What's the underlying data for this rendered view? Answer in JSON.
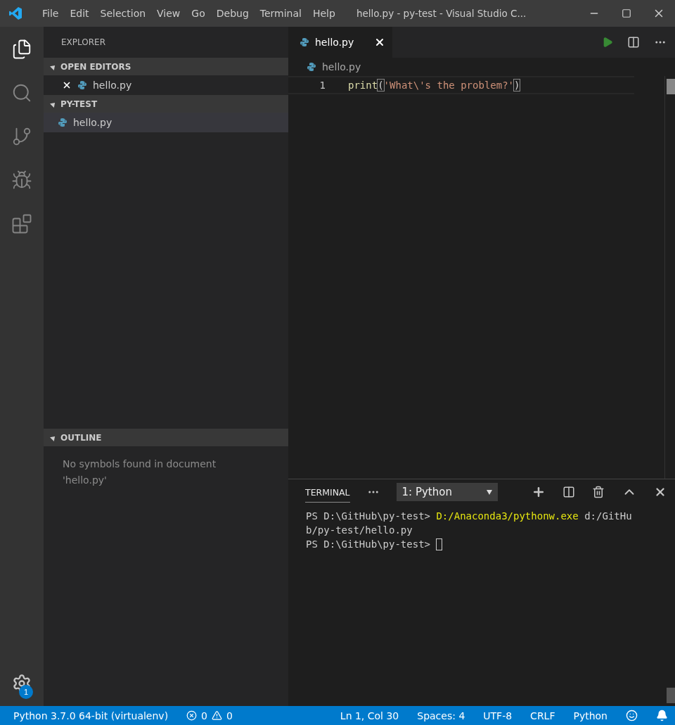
{
  "window": {
    "title": "hello.py - py-test - Visual Studio C..."
  },
  "menu": [
    "File",
    "Edit",
    "Selection",
    "View",
    "Go",
    "Debug",
    "Terminal",
    "Help"
  ],
  "activity_bar": [
    {
      "kind": "explorer",
      "selected": true
    },
    {
      "kind": "search",
      "selected": false
    },
    {
      "kind": "scm",
      "selected": false
    },
    {
      "kind": "debug",
      "selected": false
    },
    {
      "kind": "extensions",
      "selected": false
    }
  ],
  "settings_badge": "1",
  "sidebar": {
    "title": "EXPLORER",
    "sections": [
      {
        "title": "OPEN EDITORS",
        "expanded": true,
        "items": [
          {
            "label": "hello.py",
            "selected": false,
            "closable": true
          }
        ]
      },
      {
        "title": "PY-TEST",
        "expanded": true,
        "items": [
          {
            "label": "hello.py",
            "selected": true,
            "closable": false
          }
        ]
      }
    ],
    "outline": {
      "title": "OUTLINE",
      "expanded": true,
      "message": "No symbols found in document 'hello.py'"
    }
  },
  "tabs": [
    {
      "label": "hello.py",
      "selected": true
    }
  ],
  "breadcrumb": "hello.py",
  "code": [
    {
      "number": "1",
      "tokens": [
        {
          "kind": "function",
          "text": "print"
        },
        {
          "kind": "bracket",
          "text": "("
        },
        {
          "kind": "string",
          "text": "'What\\'s the problem?'"
        },
        {
          "kind": "bracket",
          "text": ")"
        }
      ]
    }
  ],
  "panel": {
    "tab": "TERMINAL",
    "dropdown": "1: Python",
    "lines": [
      [
        {
          "kind": "plain",
          "text": "PS D:\\GitHub\\py-test> "
        },
        {
          "kind": "command",
          "text": "D:/Anaconda3/pythonw.exe"
        },
        {
          "kind": "plain",
          "text": " d:/GitHu"
        }
      ],
      [
        {
          "kind": "plain",
          "text": "b/py-test/hello.py"
        }
      ],
      [
        {
          "kind": "plain",
          "text": "PS D:\\GitHub\\py-test> "
        },
        {
          "kind": "cursor"
        }
      ]
    ]
  },
  "status_bar": {
    "interpreter": "Python 3.7.0 64-bit (virtualenv)",
    "errors": "0",
    "warnings": "0",
    "position": "Ln 1, Col 30",
    "spaces": "Spaces: 4",
    "encoding": "UTF-8",
    "eol": "CRLF",
    "language": "Python"
  }
}
